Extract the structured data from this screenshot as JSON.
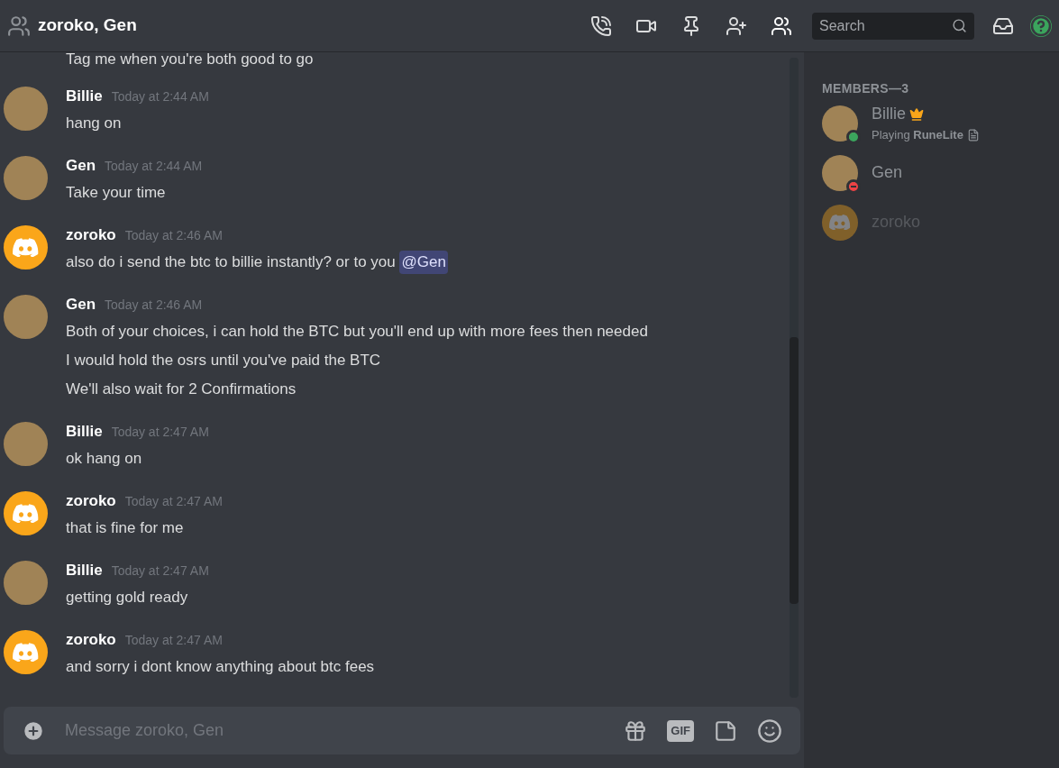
{
  "header": {
    "title": "zoroko, Gen",
    "search": {
      "placeholder": "Search"
    }
  },
  "partial_message": "Tag me when you're both good to go",
  "messages": [
    {
      "author": "Billie",
      "avatar": {
        "kind": "photo"
      },
      "time": "Today at 2:44 AM",
      "lines": [
        {
          "text": "hang on"
        }
      ]
    },
    {
      "author": "Gen",
      "avatar": {
        "kind": "photo"
      },
      "time": "Today at 2:44 AM",
      "lines": [
        {
          "text": "Take your time"
        }
      ]
    },
    {
      "author": "zoroko",
      "avatar": {
        "kind": "default"
      },
      "time": "Today at 2:46 AM",
      "lines": [
        {
          "text": "also do i send the btc to billie instantly? or to you ",
          "mention": "@Gen"
        }
      ]
    },
    {
      "author": "Gen",
      "avatar": {
        "kind": "photo"
      },
      "time": "Today at 2:46 AM",
      "lines": [
        {
          "text": "Both of your choices, i can hold the BTC but you'll end up with more fees then needed"
        },
        {
          "text": "I would hold the osrs until you've paid the BTC"
        },
        {
          "text": "We'll also wait for 2 Confirmations"
        }
      ]
    },
    {
      "author": "Billie",
      "avatar": {
        "kind": "photo"
      },
      "time": "Today at 2:47 AM",
      "lines": [
        {
          "text": "ok hang on"
        }
      ]
    },
    {
      "author": "zoroko",
      "avatar": {
        "kind": "default"
      },
      "time": "Today at 2:47 AM",
      "lines": [
        {
          "text": "that is fine for me"
        }
      ]
    },
    {
      "author": "Billie",
      "avatar": {
        "kind": "photo"
      },
      "time": "Today at 2:47 AM",
      "lines": [
        {
          "text": "getting gold ready"
        }
      ]
    },
    {
      "author": "zoroko",
      "avatar": {
        "kind": "default"
      },
      "time": "Today at 2:47 AM",
      "lines": [
        {
          "text": "and sorry i dont know anything about btc fees"
        }
      ]
    }
  ],
  "composer": {
    "placeholder": "Message zoroko, Gen",
    "gif_label": "GIF"
  },
  "members": {
    "heading": "MEMBERS—3",
    "items": [
      {
        "name": "Billie",
        "avatar": {
          "kind": "photo"
        },
        "status": {
          "kind": "online",
          "color": "#3ba55d"
        },
        "offline": false,
        "owner": true,
        "activity": "Playing **RuneLite**"
      },
      {
        "name": "Gen",
        "avatar": {
          "kind": "photo"
        },
        "status": {
          "kind": "dnd",
          "color": "#ed4245"
        },
        "offline": false,
        "owner": false
      },
      {
        "name": "zoroko",
        "avatar": {
          "kind": "default"
        },
        "offline": true,
        "owner": false
      }
    ]
  }
}
